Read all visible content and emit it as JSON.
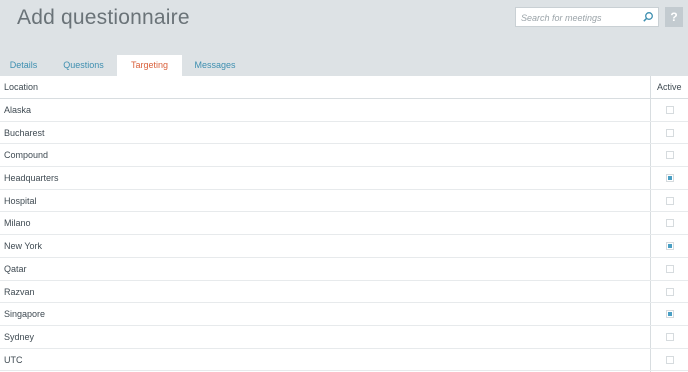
{
  "header": {
    "title": "Add questionnaire",
    "search_placeholder": "Search for meetings",
    "help_label": "?"
  },
  "tabs": [
    {
      "label": "Details",
      "active": false
    },
    {
      "label": "Questions",
      "active": false
    },
    {
      "label": "Targeting",
      "active": true
    },
    {
      "label": "Messages",
      "active": false
    }
  ],
  "table": {
    "columns": [
      "Location",
      "Active"
    ],
    "rows": [
      {
        "label": "Alaska",
        "active": false
      },
      {
        "label": "Bucharest",
        "active": false
      },
      {
        "label": "Compound",
        "active": false
      },
      {
        "label": "Headquarters",
        "active": true
      },
      {
        "label": "Hospital",
        "active": false
      },
      {
        "label": "Milano",
        "active": false
      },
      {
        "label": "New York",
        "active": true
      },
      {
        "label": "Qatar",
        "active": false
      },
      {
        "label": "Razvan",
        "active": false
      },
      {
        "label": "Singapore",
        "active": true
      },
      {
        "label": "Sydney",
        "active": false
      },
      {
        "label": "UTC",
        "active": false
      }
    ]
  },
  "colors": {
    "header_bg": "#dde2e5",
    "tab_link": "#3e8fb0",
    "tab_active": "#d9603b",
    "checkbox_fill": "#4a9fc4"
  }
}
